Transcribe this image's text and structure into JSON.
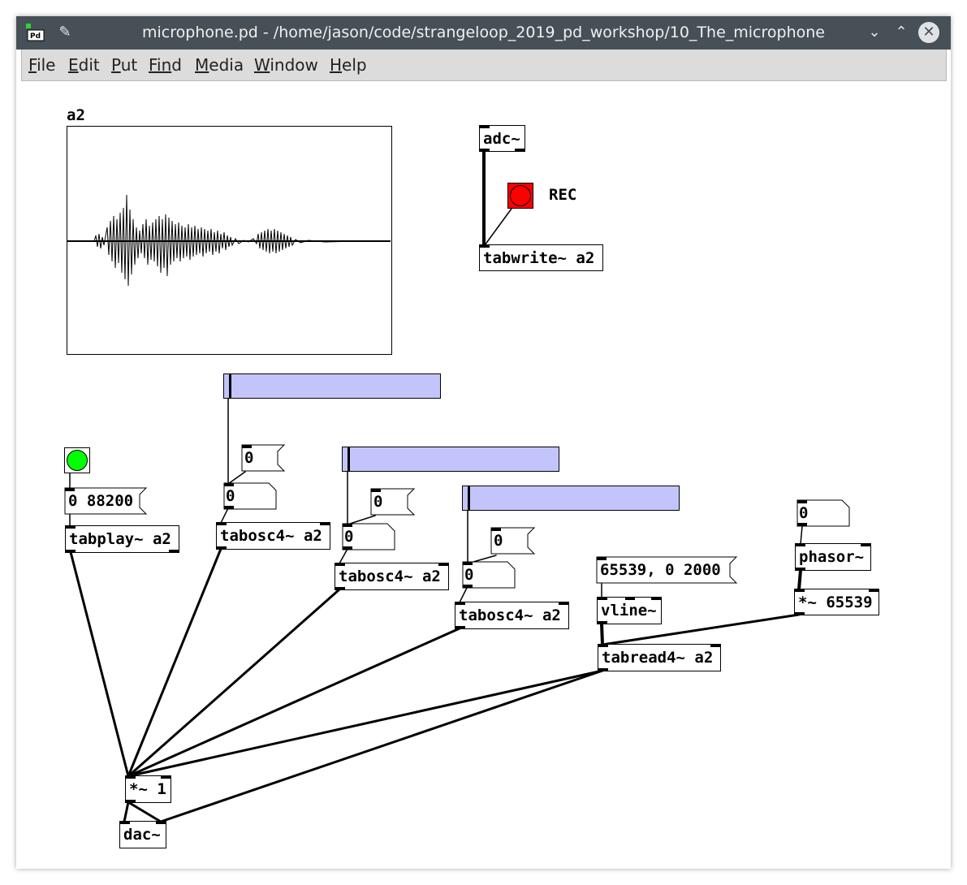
{
  "window": {
    "title": "microphone.pd - /home/jason/code/strangeloop_2019_pd_workshop/10_The_microphone",
    "icons": [
      "pd-logo-icon",
      "pin-icon",
      "minimize-icon",
      "maximize-icon",
      "close-icon"
    ]
  },
  "menu": {
    "items": [
      {
        "label": "File",
        "mnemonic": "F",
        "rest": "ile"
      },
      {
        "label": "Edit",
        "mnemonic": "E",
        "rest": "dit"
      },
      {
        "label": "Put",
        "mnemonic": "P",
        "rest": "ut"
      },
      {
        "label": "Find",
        "mnemonic": "Fin",
        "rest": "d"
      },
      {
        "label": "Media",
        "mnemonic": "M",
        "rest": "edia"
      },
      {
        "label": "Window",
        "mnemonic": "W",
        "rest": "indow"
      },
      {
        "label": "Help",
        "mnemonic": "H",
        "rest": "elp"
      }
    ]
  },
  "patch": {
    "array": {
      "name": "a2"
    },
    "objects": {
      "adc": "adc~",
      "tabwrite": "tabwrite~ a2",
      "tabplay": "tabplay~ a2",
      "tabosc1": "tabosc4~ a2",
      "tabosc2": "tabosc4~ a2",
      "tabosc3": "tabosc4~ a2",
      "vline": "vline~",
      "tabread": "tabread4~ a2",
      "phasor": "phasor~",
      "mul_big": "*~ 65539",
      "mul_one": "*~ 1",
      "dac": "dac~"
    },
    "messages": {
      "play": "0 88200",
      "ramp": "65539, 0 2000",
      "m1": "0",
      "m2": "0",
      "m3": "0"
    },
    "numbers": {
      "n1": "0",
      "n2": "0",
      "n3": "0",
      "n4": "0"
    },
    "rec_label": "REC",
    "colors": {
      "slider": "#c4c4fc",
      "rec_bang": "#ff0000",
      "play_bang": "#00ff00"
    }
  }
}
